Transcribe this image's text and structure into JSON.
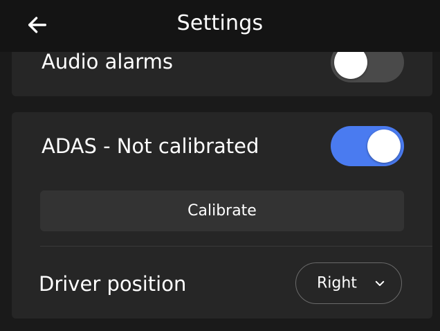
{
  "header": {
    "title": "Settings",
    "back_icon": "arrow-left-icon"
  },
  "audio_alarms": {
    "label": "Audio alarms",
    "enabled": false
  },
  "adas": {
    "label": "ADAS - Not calibrated",
    "enabled": true,
    "calibrate_label": "Calibrate"
  },
  "driver_position": {
    "label": "Driver position",
    "selected": "Right",
    "chevron_icon": "chevron-down-icon"
  },
  "colors": {
    "background": "#1a1a1a",
    "header": "#141414",
    "card": "#262626",
    "button": "#333333",
    "toggle_on": "#4a7bf0",
    "toggle_off": "#4a4a4a"
  }
}
